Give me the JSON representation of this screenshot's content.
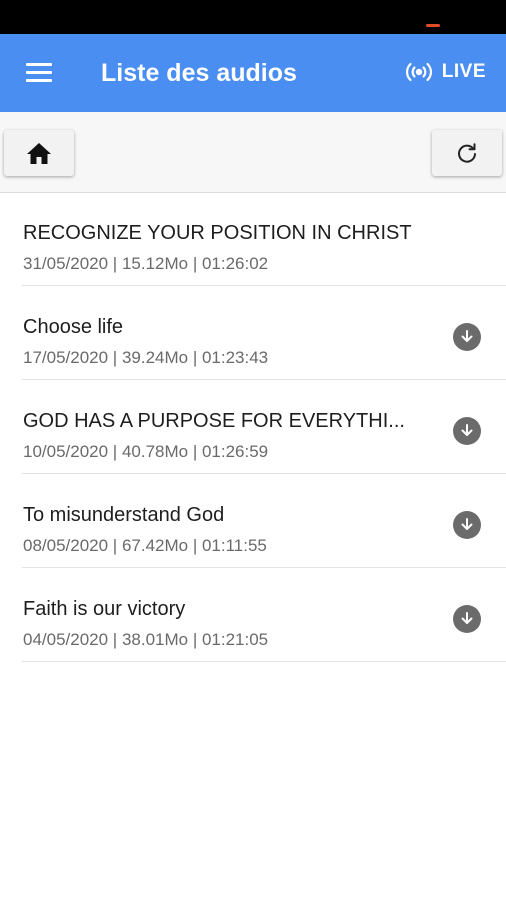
{
  "app_bar": {
    "title": "Liste des audios",
    "live_label": "LIVE",
    "color": "#4a8ef2"
  },
  "toolbar": {
    "home_icon": "home-icon",
    "refresh_icon": "refresh-icon"
  },
  "audios": [
    {
      "title": "RECOGNIZE YOUR POSITION IN CHRIST",
      "meta": "31/05/2020 | 15.12Mo | 01:26:02",
      "download": false
    },
    {
      "title": "Choose life",
      "meta": "17/05/2020 | 39.24Mo | 01:23:43",
      "download": true
    },
    {
      "title": "GOD HAS A PURPOSE FOR EVERYTHI...",
      "meta": "10/05/2020 | 40.78Mo | 01:26:59",
      "download": true
    },
    {
      "title": "To misunderstand God",
      "meta": "08/05/2020 | 67.42Mo | 01:11:55",
      "download": true
    },
    {
      "title": "Faith is our victory",
      "meta": "04/05/2020 | 38.01Mo | 01:21:05",
      "download": true
    }
  ]
}
